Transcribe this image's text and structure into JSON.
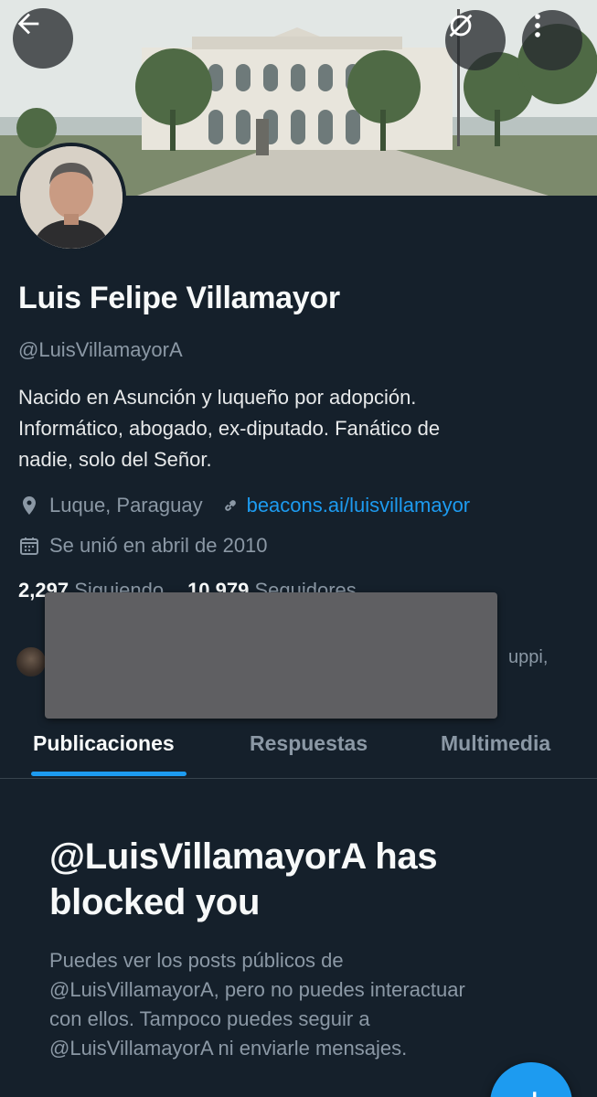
{
  "profile": {
    "name": "Luis Felipe Villamayor",
    "handle": "@LuisVillamayorA",
    "bio": [
      "Nacido en Asunción y luqueño por adopción.",
      "Informático, abogado, ex-diputado. Fanático de",
      "nadie, solo del Señor."
    ],
    "location": "Luque, Paraguay",
    "link": "beacons.ai/luisvillamayor",
    "joined": "Se unió en abril de 2010",
    "following_count": "2,297",
    "following_label": "Siguiendo",
    "followers_count": "10,979",
    "followers_label": "Seguidores",
    "followed_by_tail": "uppi,"
  },
  "icons": {
    "back": "arrow-left-icon",
    "mute": "bell-off-icon",
    "more": "more-vertical-icon",
    "location": "location-pin-icon",
    "link": "link-icon",
    "calendar": "calendar-icon",
    "compose": "plus-icon"
  },
  "tabs": [
    {
      "label": "Publicaciones",
      "active": true
    },
    {
      "label": "Respuestas",
      "active": false
    },
    {
      "label": "Multimedia",
      "active": false
    }
  ],
  "blocked": {
    "title": [
      "@LuisVillamayorA has",
      "blocked you"
    ],
    "body": [
      "Puedes ver los posts públicos de",
      "@LuisVillamayorA, pero no puedes interactuar",
      "con ellos. Tampoco puedes seguir a",
      "@LuisVillamayorA ni enviarle mensajes."
    ]
  },
  "colors": {
    "background": "#15202b",
    "accent": "#1d9bf0",
    "secondary_text": "#8b98a5",
    "divider": "#38444d"
  }
}
